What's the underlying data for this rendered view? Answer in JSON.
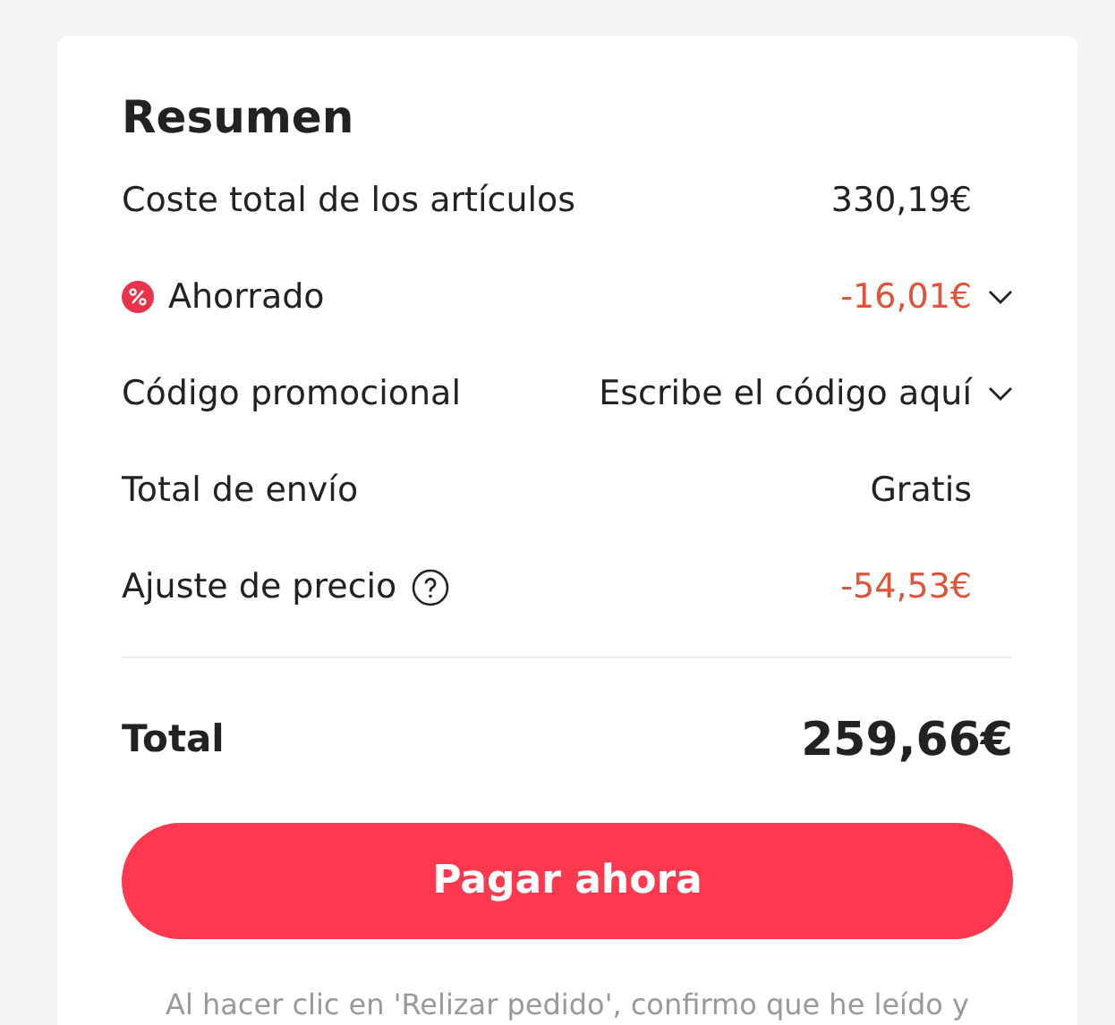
{
  "summary": {
    "title": "Resumen",
    "rows": [
      {
        "kind": "plain",
        "label": "Coste total de los artículos",
        "value": "330,19€",
        "negative": false,
        "expandable": false
      },
      {
        "kind": "discount",
        "label": "Ahorrado",
        "value": "-16,01€",
        "negative": true,
        "expandable": true
      },
      {
        "kind": "plain",
        "label": "Código promocional",
        "value": "Escribe el código aquí",
        "negative": false,
        "expandable": true
      },
      {
        "kind": "plain",
        "label": "Total de envío",
        "value": "Gratis",
        "negative": false,
        "expandable": false
      },
      {
        "kind": "help",
        "label": "Ajuste de precio",
        "value": "-54,53€",
        "negative": true,
        "expandable": false
      }
    ],
    "total": {
      "label": "Total",
      "value": "259,66€"
    },
    "pay_button": "Pagar ahora",
    "notice": "Al hacer clic en 'Relizar pedido', confirmo que he leído y"
  }
}
